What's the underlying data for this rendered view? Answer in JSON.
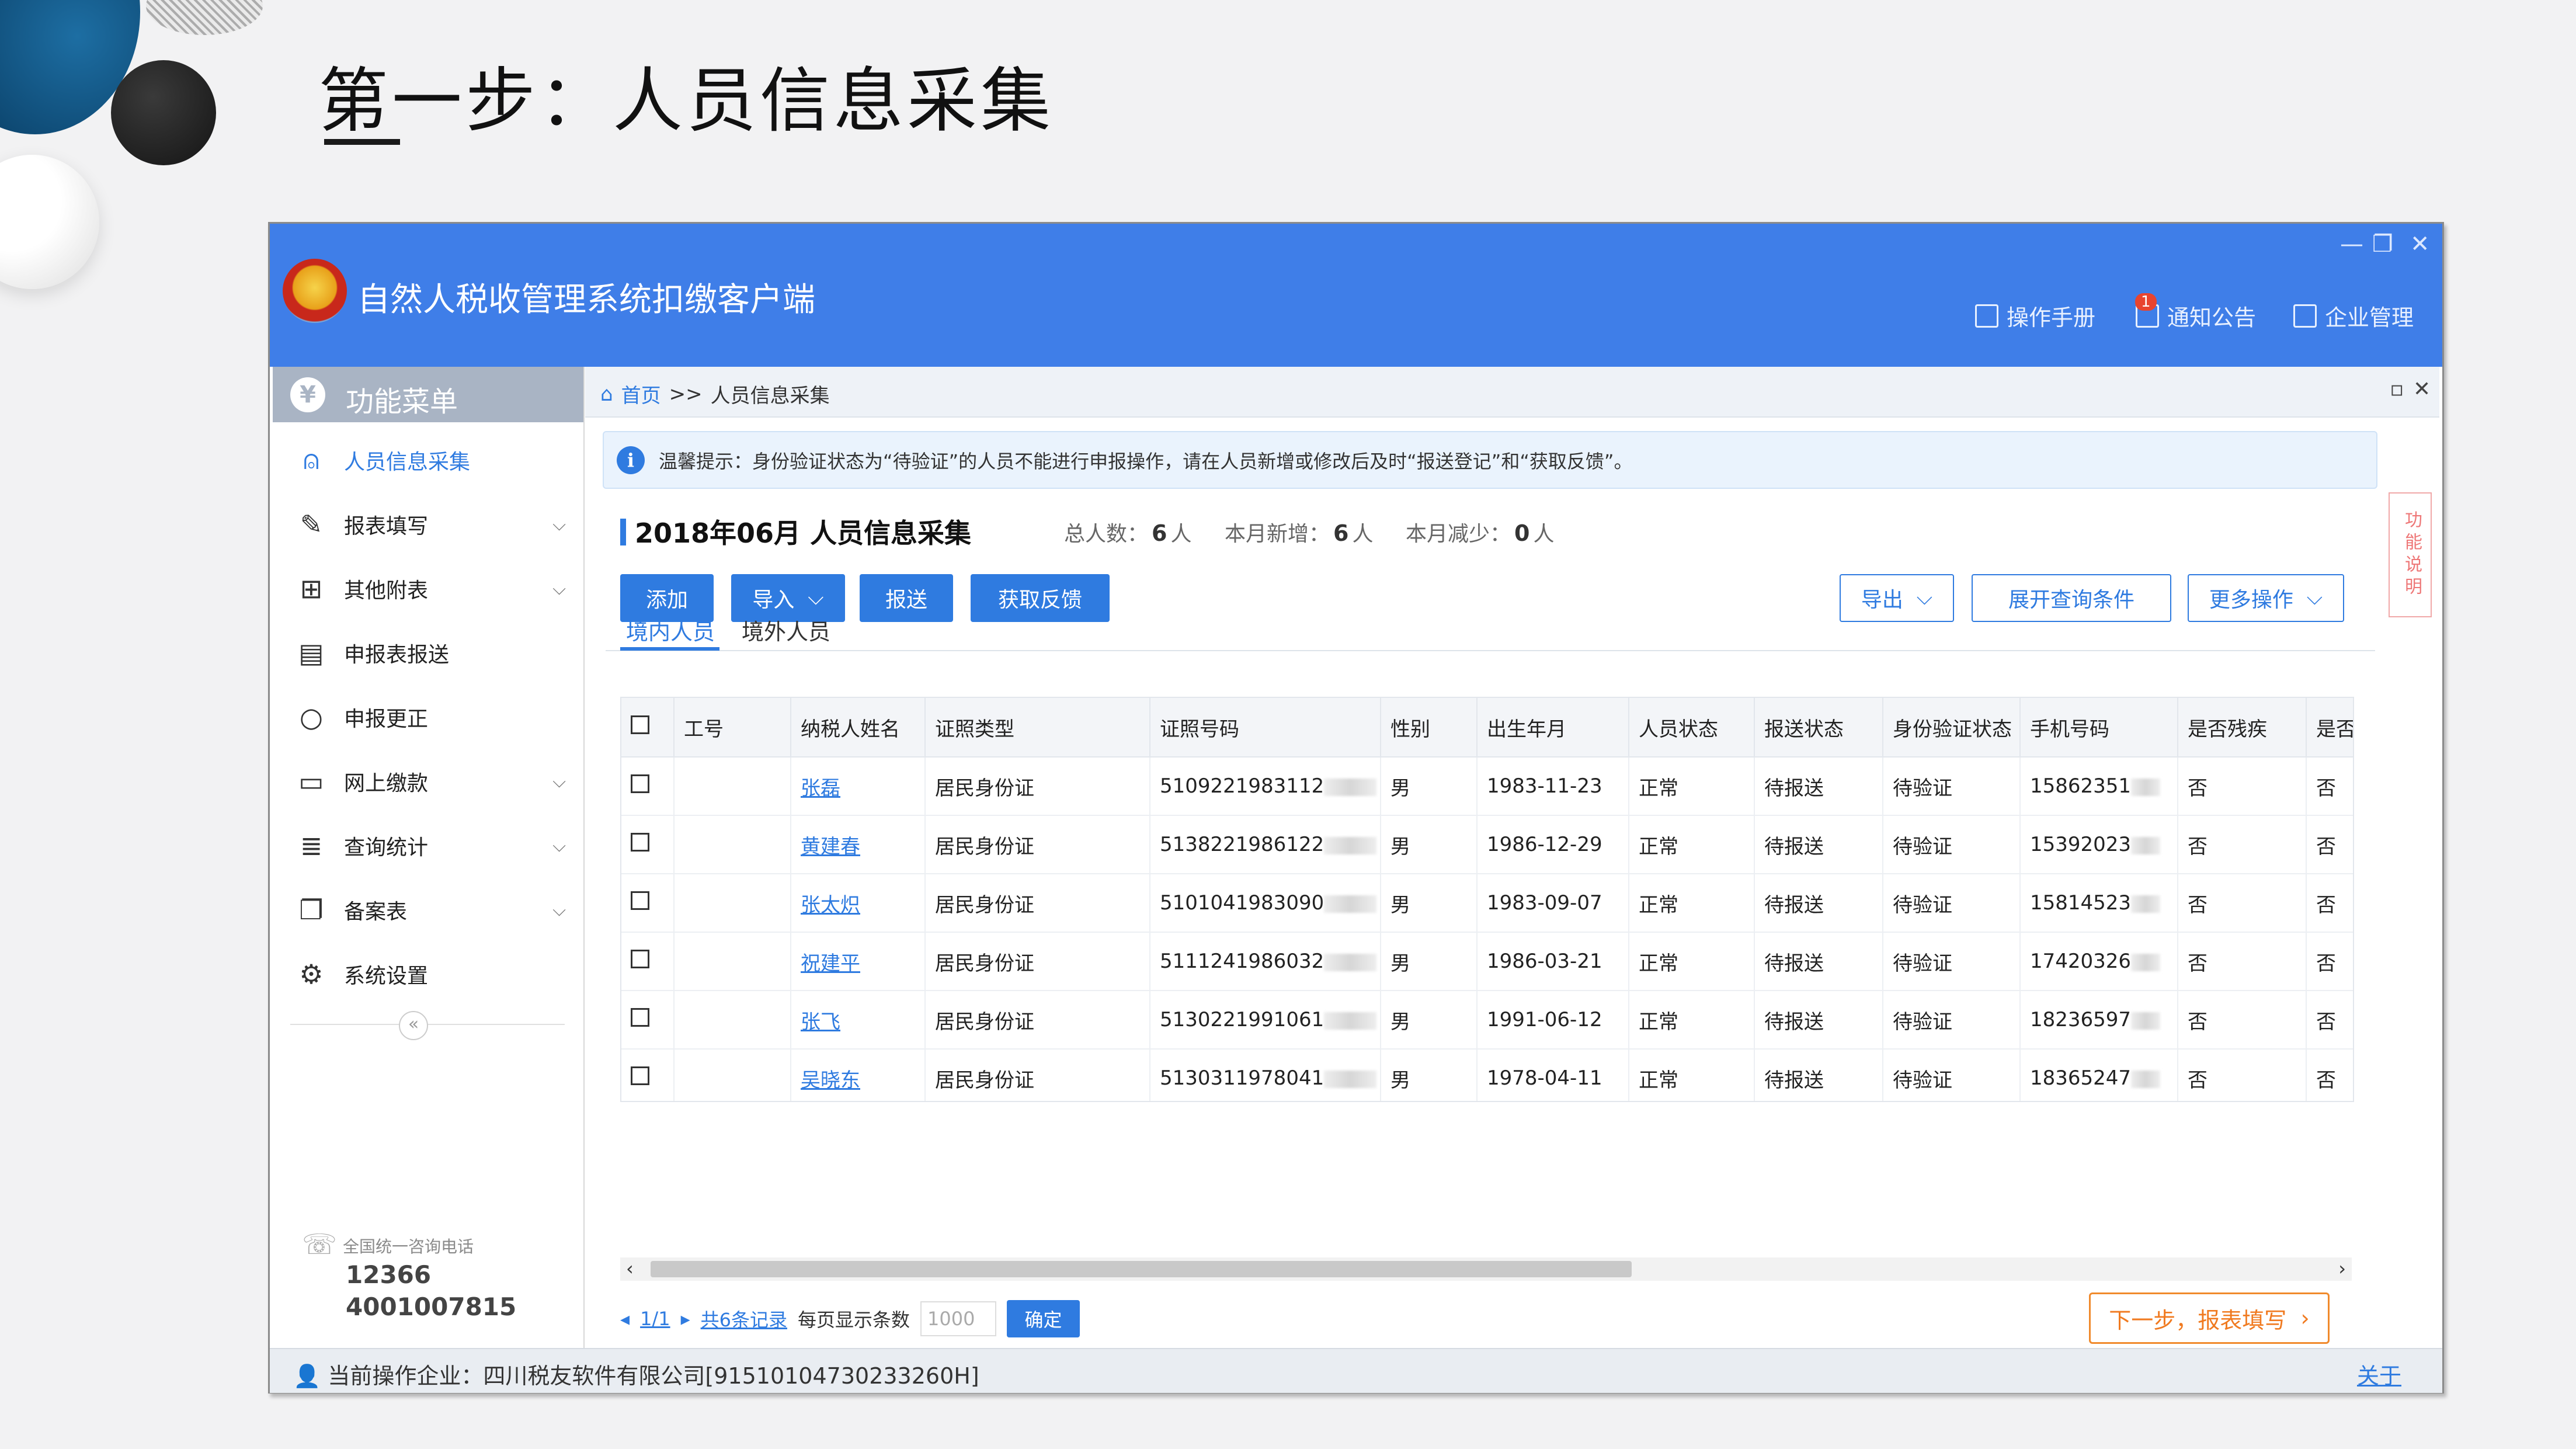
{
  "slide": {
    "title": "第一步：人员信息采集"
  },
  "app": {
    "title": "自然人税收管理系统扣缴客户端",
    "window_controls": [
      "—",
      "❐",
      "✕"
    ],
    "header_links": [
      {
        "label": "操作手册",
        "icon": "manual-icon"
      },
      {
        "label": "通知公告",
        "icon": "mail-icon",
        "badge": "1"
      },
      {
        "label": "企业管理",
        "icon": "building-icon"
      }
    ]
  },
  "sidebar": {
    "header": "功能菜单",
    "items": [
      {
        "label": "人员信息采集",
        "icon": "person-icon",
        "has_children": false,
        "active": true
      },
      {
        "label": "报表填写",
        "icon": "edit-icon",
        "has_children": true
      },
      {
        "label": "其他附表",
        "icon": "grid-icon",
        "has_children": true
      },
      {
        "label": "申报表报送",
        "icon": "send-doc-icon",
        "has_children": false
      },
      {
        "label": "申报更正",
        "icon": "search-icon",
        "has_children": false
      },
      {
        "label": "网上缴款",
        "icon": "folder-icon",
        "has_children": true
      },
      {
        "label": "查询统计",
        "icon": "query-list-icon",
        "has_children": true
      },
      {
        "label": "备案表",
        "icon": "copy-icon",
        "has_children": true
      },
      {
        "label": "系统设置",
        "icon": "gear-icon",
        "has_children": false
      }
    ],
    "collapse": "«",
    "hotline_label": "全国统一咨询电话",
    "hotline_numbers": [
      "12366",
      "4001007815"
    ]
  },
  "breadcrumb": {
    "home": "首页",
    "sep": ">>",
    "current": "人员信息采集"
  },
  "tip": "温馨提示：身份验证状态为“待验证”的人员不能进行申报操作，请在人员新增或修改后及时“报送登记”和“获取反馈”。",
  "side_tab": "功能说明",
  "section": {
    "title": "2018年06月  人员信息采集",
    "stats": [
      {
        "label": "总人数：",
        "value": "6",
        "unit": "人"
      },
      {
        "label": "本月新增：",
        "value": "6",
        "unit": "人"
      },
      {
        "label": "本月减少：",
        "value": "0",
        "unit": "人"
      }
    ]
  },
  "toolbar": {
    "add": "添加",
    "import": "导入",
    "submit": "报送",
    "feedback": "获取反馈",
    "export": "导出",
    "expand_query": "展开查询条件",
    "more": "更多操作"
  },
  "tabs": [
    "境内人员",
    "境外人员"
  ],
  "table": {
    "columns": [
      "工号",
      "纳税人姓名",
      "证照类型",
      "证照号码",
      "性别",
      "出生年月",
      "人员状态",
      "报送状态",
      "身份验证状态",
      "手机号码",
      "是否残疾",
      "是否"
    ],
    "rows": [
      {
        "name": "张磊",
        "id_type": "居民身份证",
        "id_no": "5109221983112",
        "gender": "男",
        "birth": "1983-11-23",
        "status": "正常",
        "submit_status": "待报送",
        "verify_status": "待验证",
        "phone": "15862351",
        "disabled": "否",
        "other": "否"
      },
      {
        "name": "黄建春",
        "id_type": "居民身份证",
        "id_no": "5138221986122",
        "gender": "男",
        "birth": "1986-12-29",
        "status": "正常",
        "submit_status": "待报送",
        "verify_status": "待验证",
        "phone": "15392023",
        "disabled": "否",
        "other": "否"
      },
      {
        "name": "张太炽",
        "id_type": "居民身份证",
        "id_no": "5101041983090",
        "gender": "男",
        "birth": "1983-09-07",
        "status": "正常",
        "submit_status": "待报送",
        "verify_status": "待验证",
        "phone": "15814523",
        "disabled": "否",
        "other": "否"
      },
      {
        "name": "祝建平",
        "id_type": "居民身份证",
        "id_no": "5111241986032",
        "gender": "男",
        "birth": "1986-03-21",
        "status": "正常",
        "submit_status": "待报送",
        "verify_status": "待验证",
        "phone": "17420326",
        "disabled": "否",
        "other": "否"
      },
      {
        "name": "张飞",
        "id_type": "居民身份证",
        "id_no": "5130221991061",
        "gender": "男",
        "birth": "1991-06-12",
        "status": "正常",
        "submit_status": "待报送",
        "verify_status": "待验证",
        "phone": "18236597",
        "disabled": "否",
        "other": "否"
      },
      {
        "name": "吴晓东",
        "id_type": "居民身份证",
        "id_no": "5130311978041",
        "gender": "男",
        "birth": "1978-04-11",
        "status": "正常",
        "submit_status": "待报送",
        "verify_status": "待验证",
        "phone": "18365247",
        "disabled": "否",
        "other": "否"
      }
    ]
  },
  "pager": {
    "page": "1/1",
    "total": "共6条记录",
    "per_page_label": "每页显示条数",
    "per_page_placeholder": "1000",
    "confirm": "确定"
  },
  "next_step": "下一步，报表填写",
  "status_bar": {
    "text": "当前操作企业：四川税友软件有限公司[91510104730233260H]",
    "about": "关于"
  }
}
